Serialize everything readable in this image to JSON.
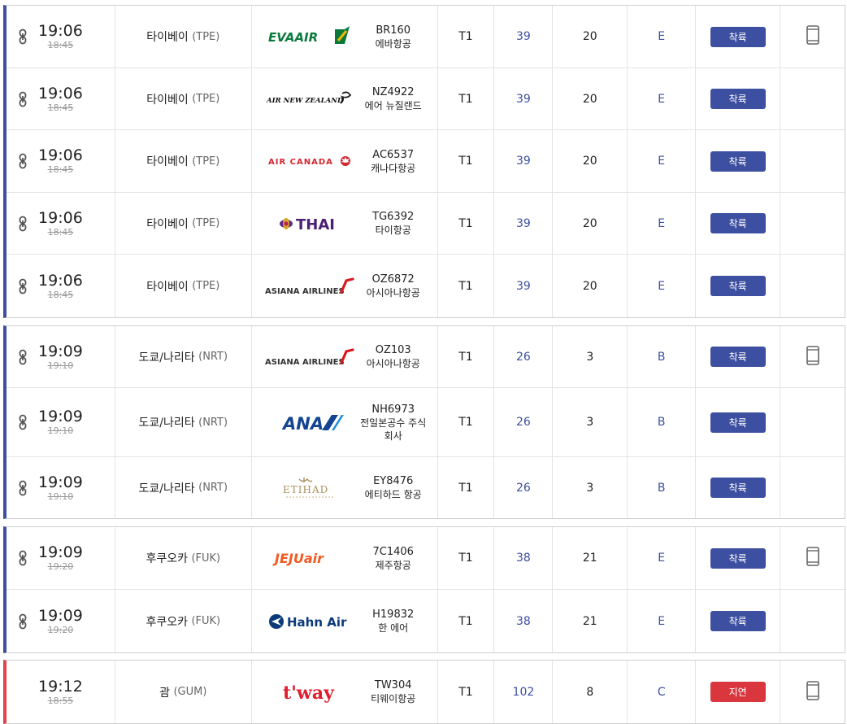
{
  "groups": [
    {
      "color": "#3d4fa0",
      "show_app_icon": true,
      "rows": [
        {
          "time": "19:06",
          "scheduled": "18:45",
          "city": "타이베이",
          "code": "(TPE)",
          "logo": "evaair-logo",
          "flight": "BR160",
          "airline": "에바항공",
          "terminal": "T1",
          "gate": "39",
          "belt": "20",
          "exit": "E",
          "status": "착륙"
        },
        {
          "time": "19:06",
          "scheduled": "18:45",
          "city": "타이베이",
          "code": "(TPE)",
          "logo": "air-new-zealand-logo",
          "flight": "NZ4922",
          "airline": "에어 뉴질랜드",
          "terminal": "T1",
          "gate": "39",
          "belt": "20",
          "exit": "E",
          "status": "착륙"
        },
        {
          "time": "19:06",
          "scheduled": "18:45",
          "city": "타이베이",
          "code": "(TPE)",
          "logo": "air-canada-logo",
          "flight": "AC6537",
          "airline": "캐나다항공",
          "terminal": "T1",
          "gate": "39",
          "belt": "20",
          "exit": "E",
          "status": "착륙"
        },
        {
          "time": "19:06",
          "scheduled": "18:45",
          "city": "타이베이",
          "code": "(TPE)",
          "logo": "thai-logo",
          "flight": "TG6392",
          "airline": "타이항공",
          "terminal": "T1",
          "gate": "39",
          "belt": "20",
          "exit": "E",
          "status": "착륙"
        },
        {
          "time": "19:06",
          "scheduled": "18:45",
          "city": "타이베이",
          "code": "(TPE)",
          "logo": "asiana-logo",
          "flight": "OZ6872",
          "airline": "아시아나항공",
          "terminal": "T1",
          "gate": "39",
          "belt": "20",
          "exit": "E",
          "status": "착륙"
        }
      ]
    },
    {
      "color": "#3d4fa0",
      "show_app_icon": true,
      "rows": [
        {
          "time": "19:09",
          "scheduled": "19:10",
          "city": "도쿄/나리타",
          "code": "(NRT)",
          "logo": "asiana-logo",
          "flight": "OZ103",
          "airline": "아시아나항공",
          "terminal": "T1",
          "gate": "26",
          "belt": "3",
          "exit": "B",
          "status": "착륙"
        },
        {
          "time": "19:09",
          "scheduled": "19:10",
          "city": "도쿄/나리타",
          "code": "(NRT)",
          "logo": "ana-logo",
          "flight": "NH6973",
          "airline": "전일본공수 주식회사",
          "terminal": "T1",
          "gate": "26",
          "belt": "3",
          "exit": "B",
          "status": "착륙"
        },
        {
          "time": "19:09",
          "scheduled": "19:10",
          "city": "도쿄/나리타",
          "code": "(NRT)",
          "logo": "etihad-logo",
          "flight": "EY8476",
          "airline": "에티하드 항공",
          "terminal": "T1",
          "gate": "26",
          "belt": "3",
          "exit": "B",
          "status": "착륙"
        }
      ]
    },
    {
      "color": "#3d4fa0",
      "show_app_icon": true,
      "rows": [
        {
          "time": "19:09",
          "scheduled": "19:20",
          "city": "후쿠오카",
          "code": "(FUK)",
          "logo": "jejuair-logo",
          "flight": "7C1406",
          "airline": "제주항공",
          "terminal": "T1",
          "gate": "38",
          "belt": "21",
          "exit": "E",
          "status": "착륙"
        },
        {
          "time": "19:09",
          "scheduled": "19:20",
          "city": "후쿠오카",
          "code": "(FUK)",
          "logo": "hahnair-logo",
          "flight": "H19832",
          "airline": "한 에어",
          "terminal": "T1",
          "gate": "38",
          "belt": "21",
          "exit": "E",
          "status": "착륙"
        }
      ]
    },
    {
      "color": "#e0444f",
      "show_app_icon": true,
      "rows": [
        {
          "time": "19:12",
          "scheduled": "18:55",
          "city": "괌",
          "code": "(GUM)",
          "logo": "tway-logo",
          "flight": "TW304",
          "airline": "티웨이항공",
          "terminal": "T1",
          "gate": "102",
          "belt": "8",
          "exit": "C",
          "status": "지연",
          "status_type": "delay"
        }
      ]
    }
  ],
  "logo_texts": {
    "evaair": "EVA AIR",
    "airnz": "AIR NEW ZEALAND",
    "aircanada": "AIR CANADA",
    "thai": "THAI",
    "asiana": "ASIANA AIRLINES",
    "ana": "ANA",
    "etihad": "ETIHAD",
    "jejuair": "JEJUair",
    "hahnair": "Hahn Air",
    "tway": "t'way"
  },
  "icons": {
    "share": "codeshare-link-icon",
    "app": "mobile-phone-icon"
  },
  "colors": {
    "accent": "#3d4fa0",
    "delay": "#d9363e",
    "delay_bar": "#e0444f"
  }
}
